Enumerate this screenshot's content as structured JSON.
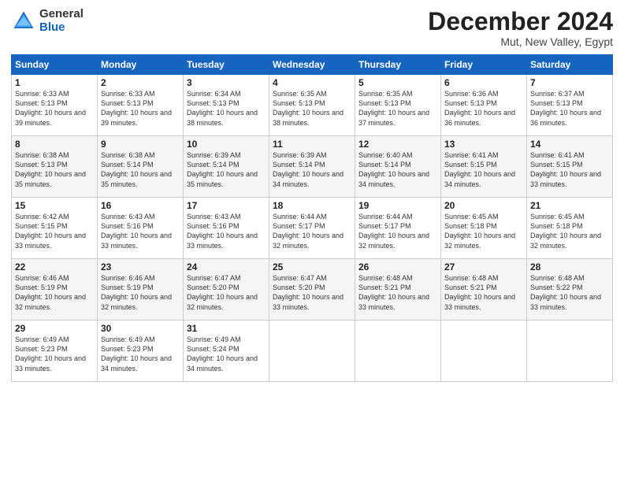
{
  "header": {
    "logo_general": "General",
    "logo_blue": "Blue",
    "month_title": "December 2024",
    "location": "Mut, New Valley, Egypt"
  },
  "days_of_week": [
    "Sunday",
    "Monday",
    "Tuesday",
    "Wednesday",
    "Thursday",
    "Friday",
    "Saturday"
  ],
  "weeks": [
    [
      {
        "num": "1",
        "rise": "6:33 AM",
        "set": "5:13 PM",
        "daylight": "10 hours and 39 minutes."
      },
      {
        "num": "2",
        "rise": "6:33 AM",
        "set": "5:13 PM",
        "daylight": "10 hours and 39 minutes."
      },
      {
        "num": "3",
        "rise": "6:34 AM",
        "set": "5:13 PM",
        "daylight": "10 hours and 38 minutes."
      },
      {
        "num": "4",
        "rise": "6:35 AM",
        "set": "5:13 PM",
        "daylight": "10 hours and 38 minutes."
      },
      {
        "num": "5",
        "rise": "6:35 AM",
        "set": "5:13 PM",
        "daylight": "10 hours and 37 minutes."
      },
      {
        "num": "6",
        "rise": "6:36 AM",
        "set": "5:13 PM",
        "daylight": "10 hours and 36 minutes."
      },
      {
        "num": "7",
        "rise": "6:37 AM",
        "set": "5:13 PM",
        "daylight": "10 hours and 36 minutes."
      }
    ],
    [
      {
        "num": "8",
        "rise": "6:38 AM",
        "set": "5:13 PM",
        "daylight": "10 hours and 35 minutes."
      },
      {
        "num": "9",
        "rise": "6:38 AM",
        "set": "5:14 PM",
        "daylight": "10 hours and 35 minutes."
      },
      {
        "num": "10",
        "rise": "6:39 AM",
        "set": "5:14 PM",
        "daylight": "10 hours and 35 minutes."
      },
      {
        "num": "11",
        "rise": "6:39 AM",
        "set": "5:14 PM",
        "daylight": "10 hours and 34 minutes."
      },
      {
        "num": "12",
        "rise": "6:40 AM",
        "set": "5:14 PM",
        "daylight": "10 hours and 34 minutes."
      },
      {
        "num": "13",
        "rise": "6:41 AM",
        "set": "5:15 PM",
        "daylight": "10 hours and 34 minutes."
      },
      {
        "num": "14",
        "rise": "6:41 AM",
        "set": "5:15 PM",
        "daylight": "10 hours and 33 minutes."
      }
    ],
    [
      {
        "num": "15",
        "rise": "6:42 AM",
        "set": "5:15 PM",
        "daylight": "10 hours and 33 minutes."
      },
      {
        "num": "16",
        "rise": "6:43 AM",
        "set": "5:16 PM",
        "daylight": "10 hours and 33 minutes."
      },
      {
        "num": "17",
        "rise": "6:43 AM",
        "set": "5:16 PM",
        "daylight": "10 hours and 33 minutes."
      },
      {
        "num": "18",
        "rise": "6:44 AM",
        "set": "5:17 PM",
        "daylight": "10 hours and 32 minutes."
      },
      {
        "num": "19",
        "rise": "6:44 AM",
        "set": "5:17 PM",
        "daylight": "10 hours and 32 minutes."
      },
      {
        "num": "20",
        "rise": "6:45 AM",
        "set": "5:18 PM",
        "daylight": "10 hours and 32 minutes."
      },
      {
        "num": "21",
        "rise": "6:45 AM",
        "set": "5:18 PM",
        "daylight": "10 hours and 32 minutes."
      }
    ],
    [
      {
        "num": "22",
        "rise": "6:46 AM",
        "set": "5:19 PM",
        "daylight": "10 hours and 32 minutes."
      },
      {
        "num": "23",
        "rise": "6:46 AM",
        "set": "5:19 PM",
        "daylight": "10 hours and 32 minutes."
      },
      {
        "num": "24",
        "rise": "6:47 AM",
        "set": "5:20 PM",
        "daylight": "10 hours and 32 minutes."
      },
      {
        "num": "25",
        "rise": "6:47 AM",
        "set": "5:20 PM",
        "daylight": "10 hours and 33 minutes."
      },
      {
        "num": "26",
        "rise": "6:48 AM",
        "set": "5:21 PM",
        "daylight": "10 hours and 33 minutes."
      },
      {
        "num": "27",
        "rise": "6:48 AM",
        "set": "5:21 PM",
        "daylight": "10 hours and 33 minutes."
      },
      {
        "num": "28",
        "rise": "6:48 AM",
        "set": "5:22 PM",
        "daylight": "10 hours and 33 minutes."
      }
    ],
    [
      {
        "num": "29",
        "rise": "6:49 AM",
        "set": "5:23 PM",
        "daylight": "10 hours and 33 minutes."
      },
      {
        "num": "30",
        "rise": "6:49 AM",
        "set": "5:23 PM",
        "daylight": "10 hours and 34 minutes."
      },
      {
        "num": "31",
        "rise": "6:49 AM",
        "set": "5:24 PM",
        "daylight": "10 hours and 34 minutes."
      },
      null,
      null,
      null,
      null
    ]
  ]
}
